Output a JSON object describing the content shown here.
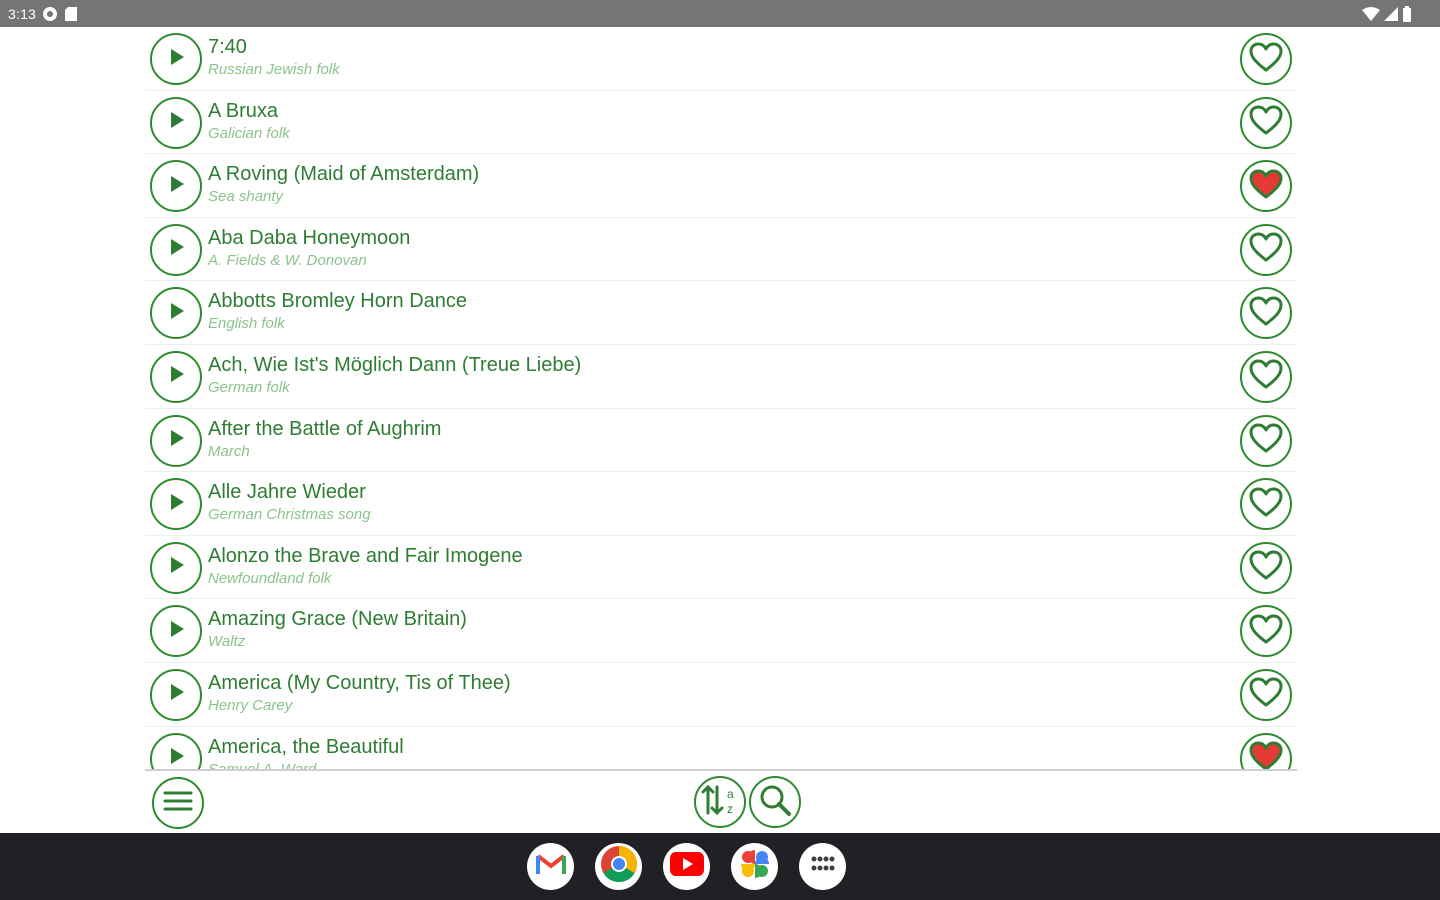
{
  "status_bar": {
    "time": "3:13",
    "left_icons": [
      "settings-icon",
      "sd-card-icon"
    ],
    "right_icons": [
      "wifi-icon",
      "cell-signal-icon",
      "battery-icon"
    ]
  },
  "songs": [
    {
      "title": "7:40",
      "subtitle": "Russian Jewish folk",
      "favorite": false
    },
    {
      "title": "A Bruxa",
      "subtitle": "Galician folk",
      "favorite": false
    },
    {
      "title": "A Roving (Maid of Amsterdam)",
      "subtitle": "Sea shanty",
      "favorite": true
    },
    {
      "title": "Aba Daba Honeymoon",
      "subtitle": "A. Fields & W. Donovan",
      "favorite": false
    },
    {
      "title": "Abbotts Bromley Horn Dance",
      "subtitle": "English folk",
      "favorite": false
    },
    {
      "title": "Ach, Wie Ist's Möglich Dann (Treue Liebe)",
      "subtitle": "German folk",
      "favorite": false
    },
    {
      "title": "After the Battle of Aughrim",
      "subtitle": "March",
      "favorite": false
    },
    {
      "title": "Alle Jahre Wieder",
      "subtitle": "German Christmas song",
      "favorite": false
    },
    {
      "title": "Alonzo the Brave and Fair Imogene",
      "subtitle": "Newfoundland folk",
      "favorite": false
    },
    {
      "title": "Amazing Grace (New Britain)",
      "subtitle": "Waltz",
      "favorite": false
    },
    {
      "title": "America (My Country, Tis of Thee)",
      "subtitle": "Henry Carey",
      "favorite": false
    },
    {
      "title": "America, the Beautiful",
      "subtitle": "Samuel A. Ward",
      "favorite": true
    }
  ],
  "toolbar": {
    "menu_icon": "menu-icon",
    "sort_icon": "sort-az-icon",
    "search_icon": "search-icon"
  },
  "taskbar": {
    "apps": [
      "gmail-icon",
      "chrome-icon",
      "youtube-icon",
      "photos-icon",
      "app-launcher-icon"
    ]
  },
  "colors": {
    "accent": "#2e7d32",
    "subtitle": "#8bc48b",
    "favorite_fill": "#e53935",
    "status_bar": "#757575",
    "taskbar": "#202124"
  }
}
